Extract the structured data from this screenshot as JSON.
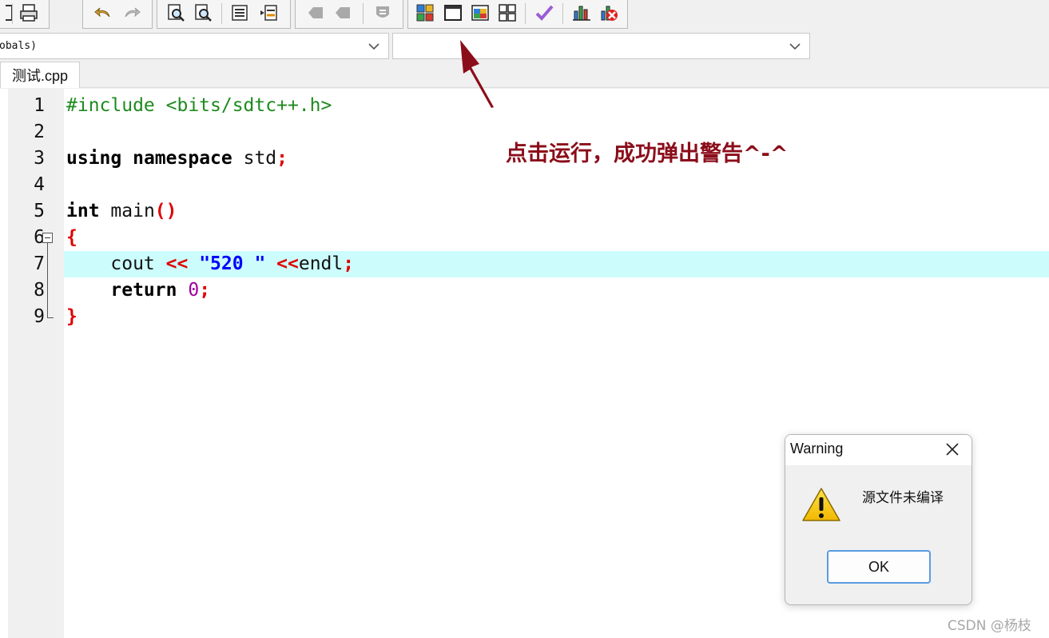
{
  "toolbar": {
    "icons": [
      "window-icon",
      "print-icon",
      "undo-icon",
      "redo-icon",
      "find-icon",
      "find-replace-icon",
      "indent-icon",
      "unindent-icon",
      "bookmark-icon",
      "bookmark-next-icon",
      "bookmark-clear-icon",
      "compile-icon",
      "run-icon",
      "compile-run-icon",
      "rebuild-icon",
      "check-icon",
      "chart-icon",
      "debug-stop-icon"
    ]
  },
  "combos": {
    "left_value": "obals)",
    "right_value": ""
  },
  "tab": {
    "label": "测试.cpp"
  },
  "editor": {
    "line_numbers": [
      "1",
      "2",
      "3",
      "4",
      "5",
      "6",
      "7",
      "8",
      "9"
    ],
    "highlighted_line": 7,
    "lines": {
      "l1": {
        "text": "#include <bits/sdtc++.h>"
      },
      "l3": {
        "kw1": "using",
        "kw2": "namespace",
        "id": "std",
        "semi": ";"
      },
      "l5": {
        "kw": "int",
        "id": "main",
        "parens": "()"
      },
      "l6": {
        "brace": "{"
      },
      "l7": {
        "id1": "cout",
        "op1": "<<",
        "str": "\"520 \"",
        "op2": "<<",
        "id2": "endl",
        "semi": ";"
      },
      "l8": {
        "kw": "return",
        "num": "0",
        "semi": ";"
      },
      "l9": {
        "brace": "}"
      }
    }
  },
  "annotation": {
    "text": "点击运行，成功弹出警告^-^",
    "color": "#8b0d1a"
  },
  "dialog": {
    "title": "Warning",
    "message": "源文件未编译",
    "ok_label": "OK",
    "icon": "warning-icon"
  },
  "watermark": "CSDN @杨枝"
}
